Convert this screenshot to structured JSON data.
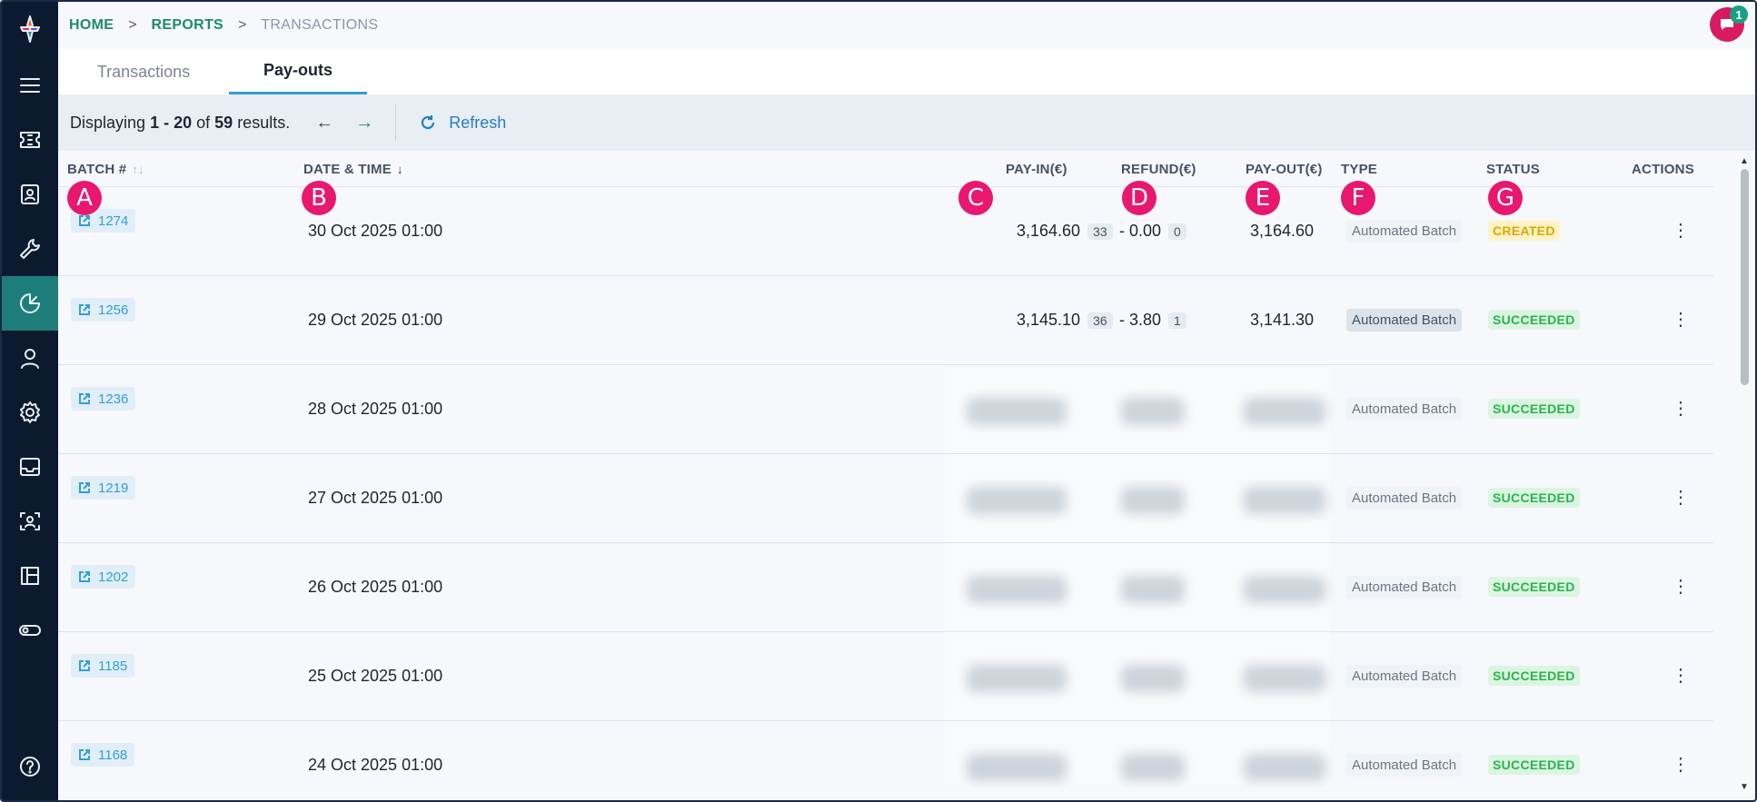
{
  "breadcrumb": [
    "HOME",
    "REPORTS",
    "TRANSACTIONS"
  ],
  "notifications": {
    "count": "1"
  },
  "tabs": [
    {
      "label": "Transactions",
      "active": false
    },
    {
      "label": "Pay-outs",
      "active": true
    }
  ],
  "toolbar": {
    "prefix": "Displaying",
    "range": "1 - 20",
    "of_text": "of",
    "total": "59",
    "suffix": "results.",
    "refresh_label": "Refresh"
  },
  "columns": {
    "batch": "BATCH #",
    "datetime": "DATE & TIME",
    "payin": "PAY-IN(€)",
    "refund": "REFUND(€)",
    "payout": "PAY-OUT(€)",
    "type": "TYPE",
    "status": "STATUS",
    "actions": "ACTIONS"
  },
  "markers": [
    "A",
    "B",
    "C",
    "D",
    "E",
    "F",
    "G"
  ],
  "rows": [
    {
      "batch": "1274",
      "datetime": "30 Oct 2025 01:00",
      "payin": "3,164.60",
      "payin_count": "33",
      "refund": "- 0.00",
      "refund_count": "0",
      "payout": "3,164.60",
      "type": "Automated Batch",
      "status": "CREATED",
      "blurred": false
    },
    {
      "batch": "1256",
      "datetime": "29 Oct 2025 01:00",
      "payin": "3,145.10",
      "payin_count": "36",
      "refund": "- 3.80",
      "refund_count": "1",
      "payout": "3,141.30",
      "type": "Automated Batch",
      "status": "SUCCEEDED",
      "blurred": false
    },
    {
      "batch": "1236",
      "datetime": "28 Oct 2025 01:00",
      "type": "Automated Batch",
      "status": "SUCCEEDED",
      "blurred": true
    },
    {
      "batch": "1219",
      "datetime": "27 Oct 2025 01:00",
      "type": "Automated Batch",
      "status": "SUCCEEDED",
      "blurred": true
    },
    {
      "batch": "1202",
      "datetime": "26 Oct 2025 01:00",
      "type": "Automated Batch",
      "status": "SUCCEEDED",
      "blurred": true
    },
    {
      "batch": "1185",
      "datetime": "25 Oct 2025 01:00",
      "type": "Automated Batch",
      "status": "SUCCEEDED",
      "blurred": true
    },
    {
      "batch": "1168",
      "datetime": "24 Oct 2025 01:00",
      "type": "Automated Batch",
      "status": "SUCCEEDED",
      "blurred": true
    }
  ],
  "colors": {
    "accent": "#1d8a6f",
    "link": "#2f9fd8",
    "marker": "#e8176f",
    "sidebar": "#0b1a2e",
    "sidebar_active": "#1d7d7b"
  },
  "sidebar_icons": [
    "menu-icon",
    "ticket-icon",
    "contact-card-icon",
    "wrench-icon",
    "pie-chart-icon",
    "user-icon",
    "settings-icon",
    "inbox-icon",
    "face-scan-icon",
    "board-icon",
    "toggle-icon",
    "help-icon"
  ]
}
